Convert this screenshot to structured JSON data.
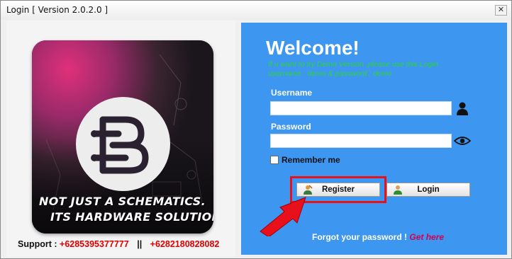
{
  "window": {
    "title": "Login [ Version 2.0.2.0 ]",
    "close_glyph": "✕"
  },
  "left": {
    "tagline_line1": "NOT JUST A SCHEMATICS.",
    "tagline_line2": "ITS HARDWARE SOLUTIONS !",
    "support_label": "Support :",
    "phone1": "+6285395377777",
    "separator": "||",
    "phone2": "+6282180828082",
    "logo_icon": "b-circuit-logo-icon"
  },
  "right": {
    "welcome": "Welcome!",
    "demo_note": "If u want to try Demo Version ,please use this Login username : demo & password : demo",
    "username_label": "Username",
    "username_value": "",
    "password_label": "Password",
    "password_value": "",
    "remember_label": "Remember me",
    "register_label": "Register",
    "login_label": "Login",
    "forgot_text": "Forgot your password !",
    "forgot_link": "Get here"
  },
  "colors": {
    "panel_blue": "#3d96f0",
    "note_green": "#2ed62e",
    "highlight_red": "#e8101a",
    "phone_red": "#e00000",
    "link_pink": "#d40050"
  }
}
